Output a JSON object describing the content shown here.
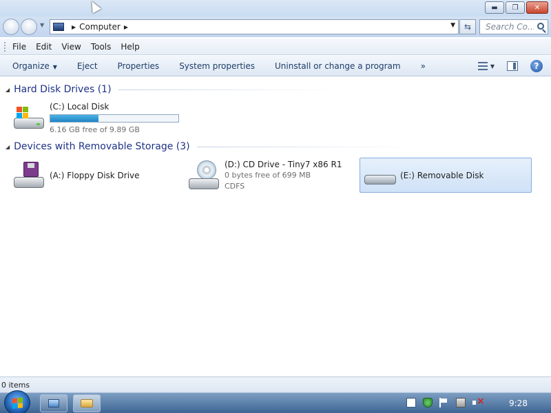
{
  "window": {
    "minimize_label": "▬",
    "maximize_label": "❐",
    "close_label": "✕"
  },
  "address": {
    "location": "Computer",
    "search_placeholder": "Search Co..."
  },
  "menu": {
    "items": [
      "File",
      "Edit",
      "View",
      "Tools",
      "Help"
    ]
  },
  "commands": {
    "organize": "Organize",
    "eject": "Eject",
    "properties": "Properties",
    "system_properties": "System properties",
    "uninstall": "Uninstall or change a program",
    "more": "»"
  },
  "groups": {
    "hard_disks": {
      "title": "Hard Disk Drives (1)",
      "drives": [
        {
          "name": "(C:) Local Disk",
          "free_text": "6.16 GB free of 9.89 GB",
          "used_fraction": 0.377
        }
      ]
    },
    "removable": {
      "title": "Devices with Removable Storage (3)",
      "drives": [
        {
          "name": "(A:) Floppy Disk Drive"
        },
        {
          "name": "(D:) CD Drive - Tiny7 x86 R1",
          "free_text": "0 bytes free of 699 MB",
          "filesystem": "CDFS"
        },
        {
          "name": "(E:) Removable Disk"
        }
      ]
    }
  },
  "status": {
    "items_text": "0 items"
  },
  "taskbar": {
    "clock": "9:28"
  }
}
